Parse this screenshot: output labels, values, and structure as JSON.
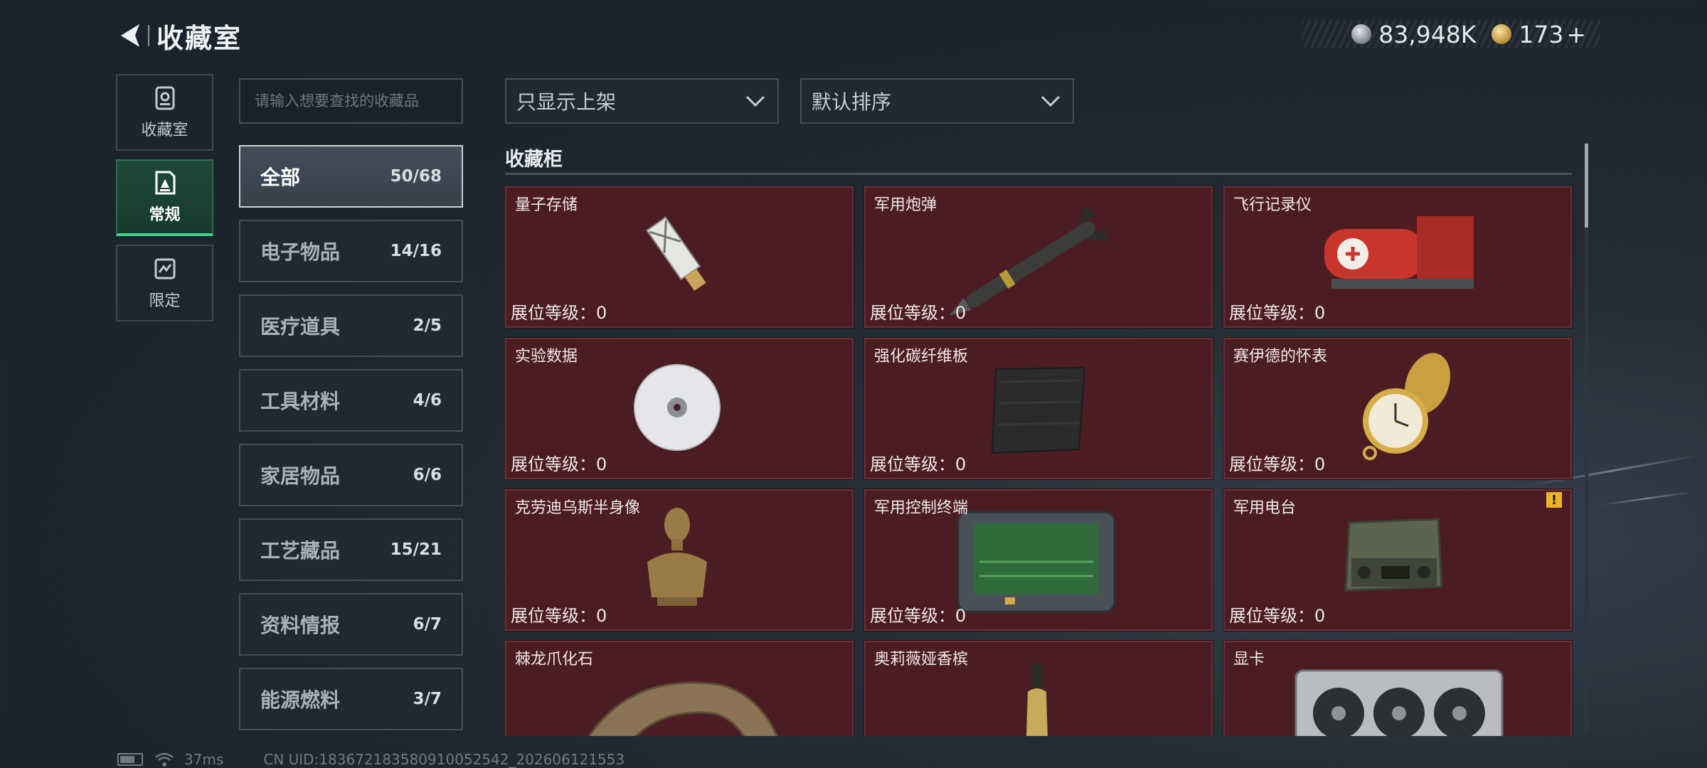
{
  "header": {
    "title": "收藏室",
    "currency_silver": "83,948K",
    "currency_gold": "173",
    "currency_gold_add": "+"
  },
  "rail": [
    {
      "label": "收藏室",
      "icon": "collection-room-icon"
    },
    {
      "label": "常规",
      "icon": "regular-icon"
    },
    {
      "label": "限定",
      "icon": "limited-icon"
    }
  ],
  "search": {
    "placeholder": "请输入想要查找的收藏品"
  },
  "categories": [
    {
      "name": "全部",
      "count": "50/68"
    },
    {
      "name": "电子物品",
      "count": "14/16"
    },
    {
      "name": "医疗道具",
      "count": "2/5"
    },
    {
      "name": "工具材料",
      "count": "4/6"
    },
    {
      "name": "家居物品",
      "count": "6/6"
    },
    {
      "name": "工艺藏品",
      "count": "15/21"
    },
    {
      "name": "资料情报",
      "count": "6/7"
    },
    {
      "name": "能源燃料",
      "count": "3/7"
    }
  ],
  "filters": {
    "display": "只显示上架",
    "sort": "默认排序"
  },
  "section": {
    "title": "收藏柜"
  },
  "items": [
    {
      "name": "量子存储",
      "level": "展位等级：0",
      "icon": "usb-drive-icon"
    },
    {
      "name": "军用炮弹",
      "level": "展位等级：0",
      "icon": "missile-icon"
    },
    {
      "name": "飞行记录仪",
      "level": "展位等级：0",
      "icon": "flight-recorder-icon"
    },
    {
      "name": "实验数据",
      "level": "展位等级：0",
      "icon": "disc-icon"
    },
    {
      "name": "强化碳纤维板",
      "level": "展位等级：0",
      "icon": "carbon-plate-icon"
    },
    {
      "name": "赛伊德的怀表",
      "level": "展位等级：0",
      "icon": "pocket-watch-icon"
    },
    {
      "name": "克劳迪乌斯半身像",
      "level": "展位等级：0",
      "icon": "bust-icon"
    },
    {
      "name": "军用控制终端",
      "level": "展位等级：0",
      "icon": "control-terminal-icon"
    },
    {
      "name": "军用电台",
      "level": "展位等级：0",
      "icon": "radio-icon",
      "badge": "!"
    },
    {
      "name": "棘龙爪化石",
      "level": "",
      "icon": "claw-fossil-icon"
    },
    {
      "name": "奥莉薇娅香槟",
      "level": "",
      "icon": "champagne-icon"
    },
    {
      "name": "显卡",
      "level": "",
      "icon": "graphics-card-icon"
    }
  ],
  "footer": {
    "ping": "37ms",
    "uid": "CN UID:183672183580910052542_202606121553"
  },
  "colors": {
    "accent_green": "#3fd28e",
    "card_bg": "#4b1d23",
    "warn": "#e8b42a"
  }
}
